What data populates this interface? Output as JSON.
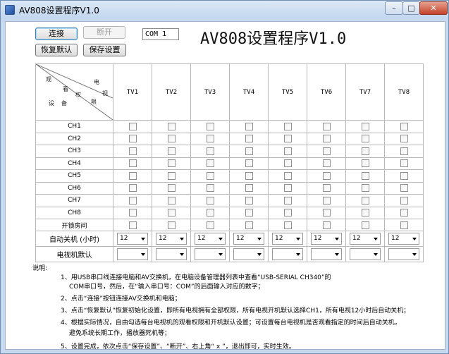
{
  "window": {
    "title": "AV808设置程序V1.0",
    "controls": {
      "minimize": "–",
      "maximize": "□",
      "close": "✕"
    }
  },
  "toolbar": {
    "connect": "连接",
    "disconnect": "断开",
    "port": "COM 1",
    "restore_default": "恢复默认",
    "save": "保存设置"
  },
  "heading": "AV808设置程序V1.0",
  "table": {
    "corner": {
      "top_left": [
        "观",
        "看"
      ],
      "top_right": [
        "电",
        "视"
      ],
      "middle": [
        "权",
        "限"
      ],
      "bottom": [
        "设",
        "备"
      ]
    },
    "columns": [
      "TV1",
      "TV2",
      "TV3",
      "TV4",
      "TV5",
      "TV6",
      "TV7",
      "TV8"
    ],
    "channel_rows": [
      "CH1",
      "CH2",
      "CH3",
      "CH4",
      "CH5",
      "CH6",
      "CH7",
      "CH8"
    ],
    "lock_row": "开锁房间",
    "auto_off_row": "自动关机 (小时)",
    "auto_off_value": "12",
    "tv_default_row": "电视机默认"
  },
  "notes": {
    "title": "说明:",
    "lines": [
      "1、用USB串口线连接电脑和AV交换机，在电脑设备管理器列表中查看“USB-SERIAL CH340”的",
      "COM串口号，然后，在“输入串口号：COM”的后面输入对应的数字；",
      "2、点击“连接”按钮连接AV交换机和电脑；",
      "3、点击“恢复默认”恢复初始化设置，即所有电视拥有全部权限，所有电视开机默认选择CH1，所有电视12小时后自动关机；",
      "4、根据实际情况，自由勾选每台电视机的观看权限和开机默认设置；可设置每台电视机是否观看指定的时间后自动关机，",
      "避免系统长期工作，播放器死机等；",
      "5、设置完成，依次点击“保存设置”、“断开”、右上角“ x ”，退出即可，实时生效。"
    ]
  }
}
